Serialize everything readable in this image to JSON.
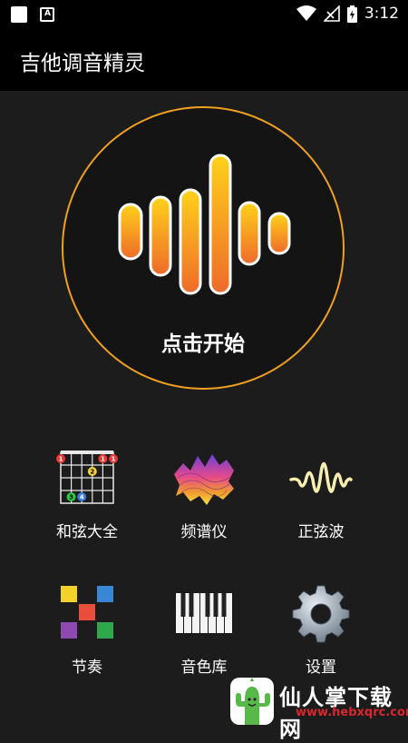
{
  "status_bar": {
    "time": "3:12",
    "a_icon_letter": "A",
    "icons": [
      "notification-square-icon",
      "a-notification-icon",
      "wifi-icon",
      "signal-icon",
      "battery-icon"
    ]
  },
  "app_bar": {
    "title": "吉他调音精灵"
  },
  "start": {
    "label": "点击开始"
  },
  "features": [
    {
      "label": "和弦大全",
      "icon": "chord-diagram-icon"
    },
    {
      "label": "频谱仪",
      "icon": "spectrum-icon"
    },
    {
      "label": "正弦波",
      "icon": "sine-wave-icon"
    },
    {
      "label": "节奏",
      "icon": "rhythm-blocks-icon"
    },
    {
      "label": "音色库",
      "icon": "piano-icon"
    },
    {
      "label": "设置",
      "icon": "gear-icon"
    }
  ],
  "chord_dots": [
    "1",
    "1",
    "1",
    "2",
    "3",
    "4"
  ],
  "watermark": {
    "text": "仙人掌下载网",
    "url": "www.hebxqrc.com"
  },
  "colors": {
    "accent": "#f0a020",
    "background": "#1c1c1c",
    "bar": "#000000"
  }
}
